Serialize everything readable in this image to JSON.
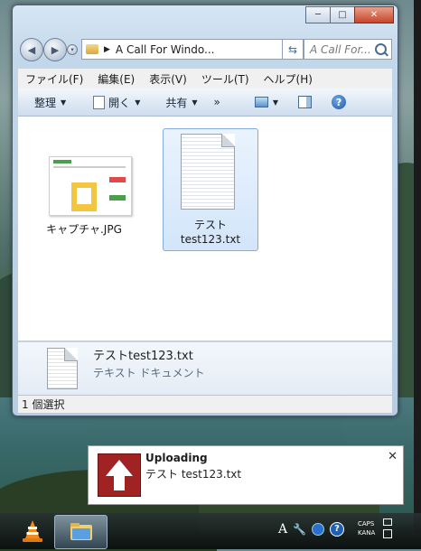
{
  "window": {
    "minimize": "─",
    "maximize": "□",
    "close": "✕"
  },
  "nav": {
    "address": "A Call For Windo...",
    "search_placeholder": "A Call For..."
  },
  "menu": [
    "ファイル(F)",
    "編集(E)",
    "表示(V)",
    "ツール(T)",
    "ヘルプ(H)"
  ],
  "toolbar": {
    "organize": "整理",
    "open": "開く",
    "share": "共有",
    "more": "»",
    "help": "?"
  },
  "files": [
    {
      "name": "キャプチャ.JPG",
      "type": "image",
      "selected": false
    },
    {
      "name_line1": "テスト",
      "name_line2": "test123.txt",
      "type": "text",
      "selected": true
    }
  ],
  "details": {
    "filename": "テストtest123.txt",
    "filetype": "テキスト ドキュメント"
  },
  "status": "1 個選択",
  "notification": {
    "title": "Uploading",
    "message": "テスト test123.txt",
    "close": "✕"
  },
  "tray": {
    "ime": "A",
    "caps": "CAPS",
    "kana": "KANA",
    "help": "?"
  }
}
